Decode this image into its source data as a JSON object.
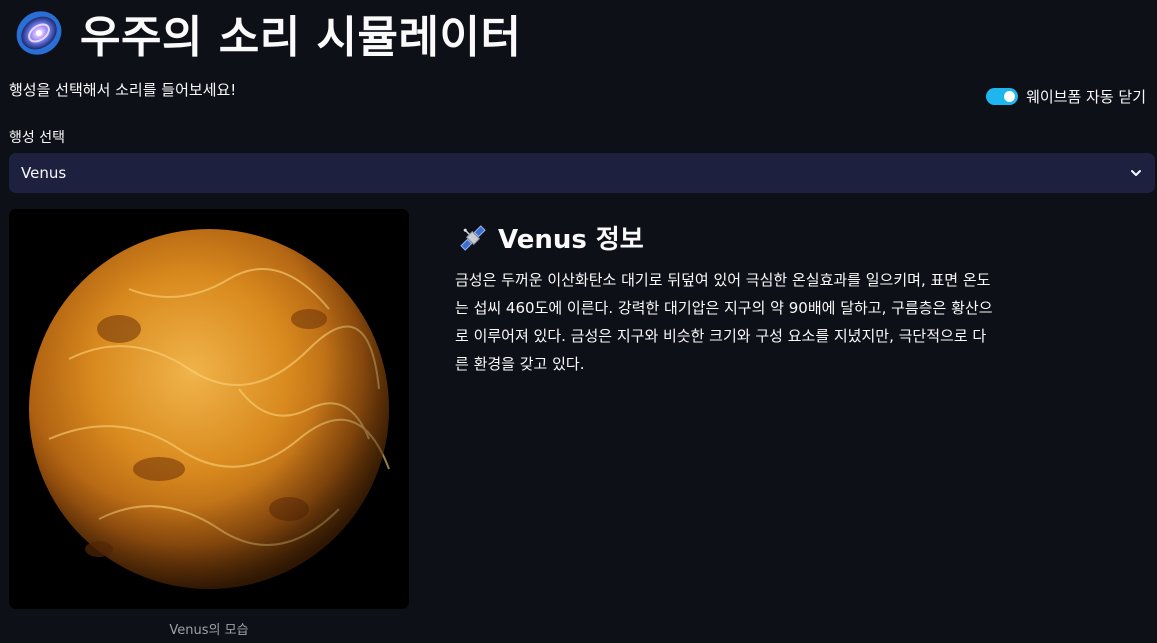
{
  "header": {
    "title": "우주의 소리 시뮬레이터",
    "subtitle": "행성을 선택해서 소리를 들어보세요!",
    "icon": "galaxy-icon"
  },
  "toggle": {
    "label": "웨이브폼 자동 닫기",
    "checked": true,
    "color": "#1fb6f0"
  },
  "planet_select": {
    "label": "행성 선택",
    "selected": "Venus"
  },
  "planet_image": {
    "caption": "Venus의 모습"
  },
  "info": {
    "icon": "satellite-icon",
    "title": "Venus 정보",
    "description": "금성은 두꺼운 이산화탄소 대기로 뒤덮여 있어 극심한 온실효과를 일으키며, 표면 온도는 섭씨 460도에 이른다. 강력한 대기압은 지구의 약 90배에 달하고, 구름층은 황산으로 이루어져 있다. 금성은 지구와 비슷한 크기와 구성 요소를 지녔지만, 극단적으로 다른 환경을 갖고 있다."
  },
  "colors": {
    "background": "#0e1018",
    "select_background": "#1e2040",
    "planet": "#d98a1e"
  }
}
